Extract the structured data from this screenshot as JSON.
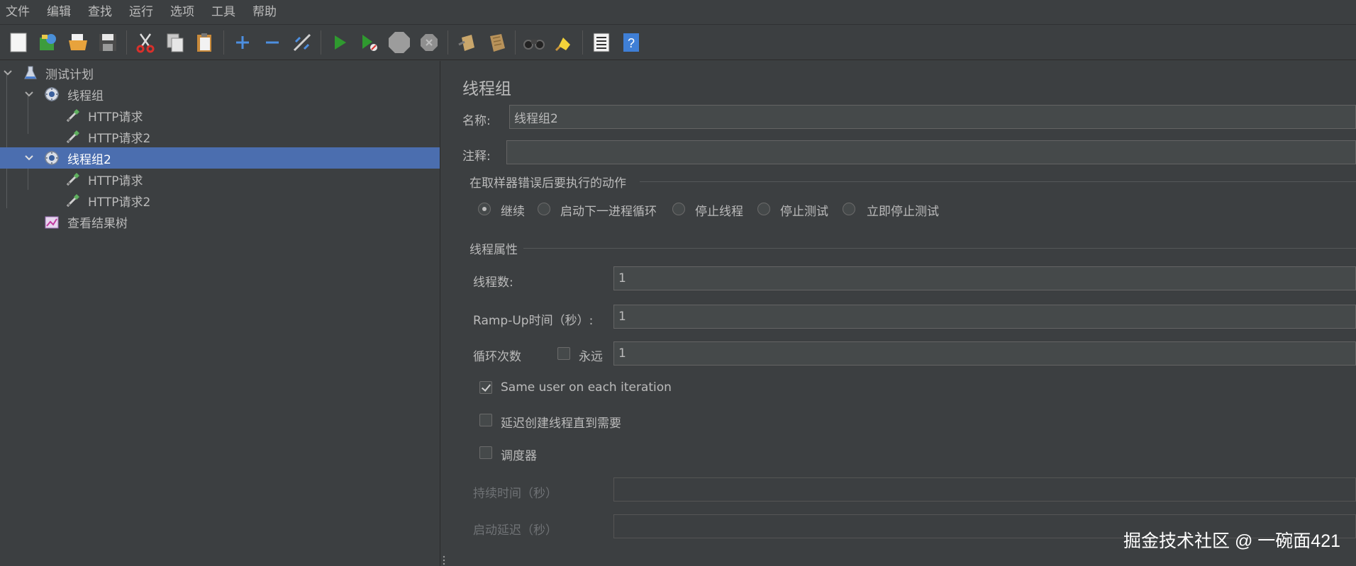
{
  "menu": [
    "文件",
    "编辑",
    "查找",
    "运行",
    "选项",
    "工具",
    "帮助"
  ],
  "toolbar": {
    "icons": [
      "new-icon",
      "templates-icon",
      "open-icon",
      "save-icon",
      "cut-icon",
      "copy-icon",
      "paste-icon",
      "expand-icon",
      "collapse-icon",
      "toggle-icon",
      "start-icon",
      "start-no-pause-icon",
      "stop-icon",
      "shutdown-icon",
      "clear-icon",
      "clear-all-icon",
      "search-icon",
      "reset-search-icon",
      "function-helper-icon",
      "help-icon"
    ]
  },
  "tree": {
    "items": [
      {
        "label": "测试计划",
        "icon": "test-plan-icon"
      },
      {
        "label": "线程组",
        "icon": "thread-group-icon"
      },
      {
        "label": "HTTP请求",
        "icon": "http-sampler-icon"
      },
      {
        "label": "HTTP请求2",
        "icon": "http-sampler-icon"
      },
      {
        "label": "线程组2",
        "icon": "thread-group-icon",
        "selected": true
      },
      {
        "label": "HTTP请求",
        "icon": "http-sampler-icon"
      },
      {
        "label": "HTTP请求2",
        "icon": "http-sampler-icon"
      },
      {
        "label": "查看结果树",
        "icon": "result-tree-icon"
      }
    ]
  },
  "panel": {
    "title": "线程组",
    "name_label": "名称:",
    "name_value": "线程组2",
    "comment_label": "注释:",
    "comment_value": "",
    "error_action": {
      "legend": "在取样器错误后要执行的动作",
      "options": [
        "继续",
        "启动下一进程循环",
        "停止线程",
        "停止测试",
        "立即停止测试"
      ],
      "selected": "继续"
    },
    "thread_props": {
      "legend": "线程属性",
      "threads_label": "线程数:",
      "threads_value": "1",
      "rampup_label": "Ramp-Up时间（秒）:",
      "rampup_value": "1",
      "loop_label": "循环次数",
      "forever_label": "永远",
      "forever_checked": false,
      "loop_value": "1",
      "same_user_label": "Same user on each iteration",
      "same_user_checked": true,
      "delay_label": "延迟创建线程直到需要",
      "delay_checked": false,
      "scheduler_label": "调度器",
      "scheduler_checked": false,
      "duration_label": "持续时间（秒）",
      "duration_value": "",
      "startup_delay_label": "启动延迟（秒）",
      "startup_delay_value": ""
    }
  },
  "watermark": "掘金技术社区 @ 一碗面421"
}
